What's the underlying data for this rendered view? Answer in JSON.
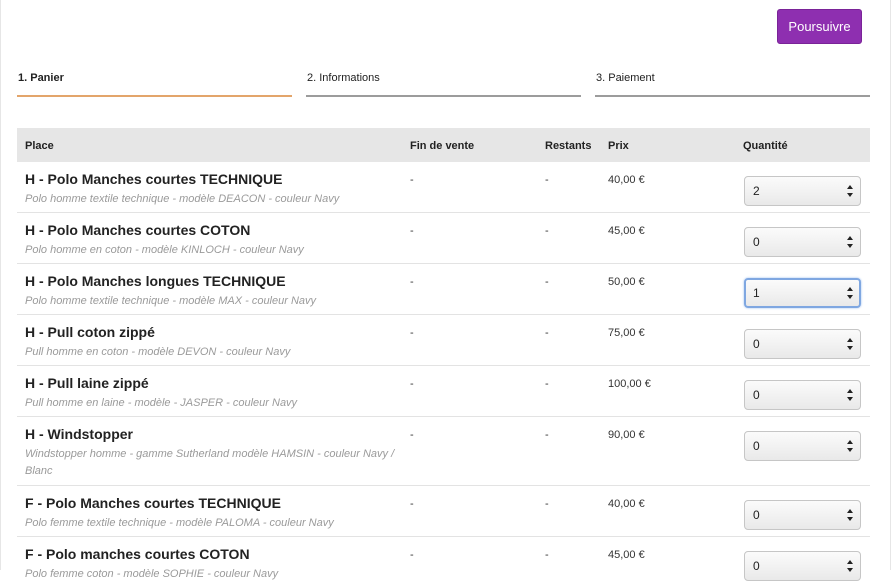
{
  "continue_label": "Poursuivre",
  "steps": [
    {
      "label": "1. Panier",
      "active": true
    },
    {
      "label": "2. Informations",
      "active": false
    },
    {
      "label": "3. Paiement",
      "active": false
    }
  ],
  "colors": {
    "button": "#8e2fb0",
    "active_step": "#e3a56b",
    "inactive_step": "#9c9c9c",
    "header_bg": "#e6e6e6",
    "focus_ring": "#7fa7e1"
  },
  "table": {
    "columns": {
      "place": "Place",
      "fin": "Fin de vente",
      "rest": "Restants",
      "prix": "Prix",
      "qty": "Quantité"
    },
    "rows": [
      {
        "name": "H - Polo Manches courtes TECHNIQUE",
        "desc": "Polo homme textile technique - modèle DEACON - couleur Navy",
        "fin": "-",
        "rest": "-",
        "prix": "40,00 €",
        "qty": "2",
        "focused": false
      },
      {
        "name": "H - Polo Manches courtes COTON",
        "desc": "Polo homme en coton - modèle KINLOCH - couleur Navy",
        "fin": "-",
        "rest": "-",
        "prix": "45,00 €",
        "qty": "0",
        "focused": false
      },
      {
        "name": "H - Polo Manches longues TECHNIQUE",
        "desc": "Polo homme textile technique - modèle MAX - couleur Navy",
        "fin": "-",
        "rest": "-",
        "prix": "50,00 €",
        "qty": "1",
        "focused": true
      },
      {
        "name": "H - Pull coton zippé",
        "desc": "Pull homme en coton - modèle DEVON - couleur Navy",
        "fin": "-",
        "rest": "-",
        "prix": "75,00 €",
        "qty": "0",
        "focused": false
      },
      {
        "name": "H - Pull laine zippé",
        "desc": "Pull homme en laine - modèle - JASPER - couleur Navy",
        "fin": "-",
        "rest": "-",
        "prix": "100,00 €",
        "qty": "0",
        "focused": false
      },
      {
        "name": "H - Windstopper",
        "desc": "Windstopper homme - gamme Sutherland modèle HAMSIN - couleur Navy / Blanc",
        "fin": "-",
        "rest": "-",
        "prix": "90,00 €",
        "qty": "0",
        "focused": false
      },
      {
        "name": "F - Polo Manches courtes TECHNIQUE",
        "desc": "Polo femme textile technique - modèle PALOMA - couleur Navy",
        "fin": "-",
        "rest": "-",
        "prix": "40,00 €",
        "qty": "0",
        "focused": false
      },
      {
        "name": "F - Polo manches courtes COTON",
        "desc": "Polo femme coton - modèle SOPHIE - couleur Navy",
        "fin": "-",
        "rest": "-",
        "prix": "45,00 €",
        "qty": "0",
        "focused": false
      }
    ]
  }
}
